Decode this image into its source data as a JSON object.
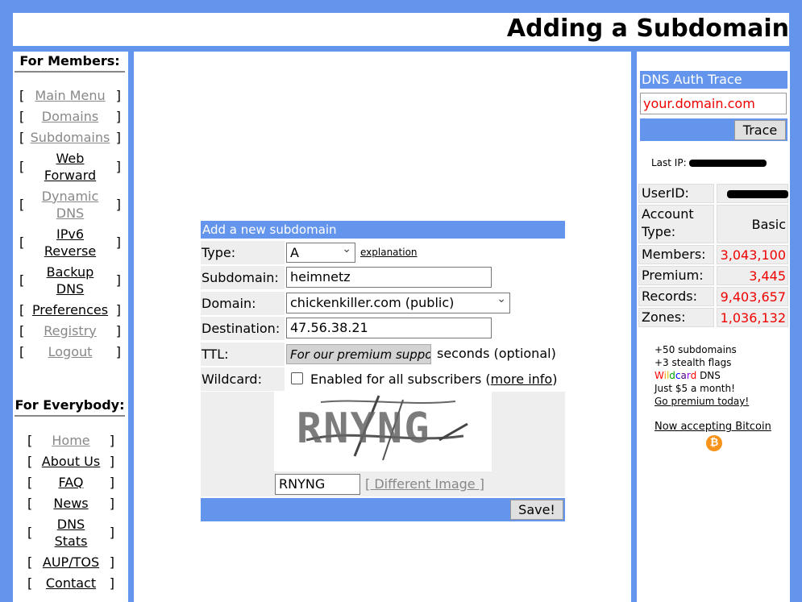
{
  "header": {
    "title": "Adding a Subdomain"
  },
  "left": {
    "members_title": "For Members:",
    "members": [
      {
        "label": "Main Menu",
        "dim": true
      },
      {
        "label": "Domains",
        "dim": true
      },
      {
        "label": "Subdomains",
        "dim": true
      },
      {
        "label": "Web Forward",
        "dim": false
      },
      {
        "label": "Dynamic DNS",
        "dim": true
      },
      {
        "label": "IPv6 Reverse",
        "dim": false
      },
      {
        "label": "Backup DNS",
        "dim": false
      },
      {
        "label": "Preferences",
        "dim": false
      },
      {
        "label": "Registry",
        "dim": true
      },
      {
        "label": "Logout",
        "dim": true
      }
    ],
    "everybody_title": "For Everybody:",
    "everybody": [
      {
        "label": "Home",
        "dim": true
      },
      {
        "label": "About Us",
        "dim": false
      },
      {
        "label": "FAQ",
        "dim": false
      },
      {
        "label": "News",
        "dim": false
      },
      {
        "label": "DNS Stats",
        "dim": false
      },
      {
        "label": "AUP/TOS",
        "dim": false
      },
      {
        "label": "Contact",
        "dim": false
      }
    ],
    "bracket_open": "[",
    "bracket_close": "]"
  },
  "form": {
    "title": "Add a new subdomain",
    "type_label": "Type:",
    "type_value": "A",
    "explanation_link": "explanation",
    "subdomain_label": "Subdomain:",
    "subdomain_value": "heimnetz",
    "domain_label": "Domain:",
    "domain_value": "chickenkiller.com (public)",
    "destination_label": "Destination:",
    "destination_value": "47.56.38.21",
    "ttl_label": "TTL:",
    "ttl_placeholder": "For our premium suppo",
    "ttl_suffix": "seconds (optional)",
    "wildcard_label": "Wildcard:",
    "wildcard_text": "Enabled for all subscribers",
    "wildcard_paren_open": "(",
    "wildcard_more_info": "more info",
    "wildcard_paren_close": ")",
    "captcha_text": "RNYNG",
    "captcha_input_value": "RNYNG",
    "different_image": "[ Different Image ]",
    "save_button": "Save!"
  },
  "right": {
    "trace_title": "DNS Auth Trace",
    "trace_input": "your.domain.com",
    "trace_button": "Trace",
    "last_ip_label": "Last IP:",
    "stats": [
      {
        "label": "UserID:",
        "value": ""
      },
      {
        "label": "Account Type:",
        "value": "Basic"
      },
      {
        "label": "Members:",
        "value": "3,043,100"
      },
      {
        "label": "Premium:",
        "value": "3,445"
      },
      {
        "label": "Records:",
        "value": "9,403,657"
      },
      {
        "label": "Zones:",
        "value": "1,036,132"
      }
    ],
    "promo_line1": "+50 subdomains",
    "promo_line2": "+3 stealth flags",
    "wildcard_word": [
      "W",
      "i",
      "l",
      "d",
      "c",
      "a",
      "r",
      "d"
    ],
    "wildcard_colors": [
      "#ff0000",
      "#ff8c00",
      "#d4c400",
      "#00a000",
      "#0000ff",
      "#4b0082",
      "#8b00ff",
      "#ff0000"
    ],
    "promo_dns": " DNS",
    "promo_line4": "Just $5 a month!",
    "promo_link": "Go premium today!",
    "bitcoin_link": "Now accepting Bitcoin",
    "bitcoin_symbol": "₿",
    "colors": {
      "accent": "#6495ed",
      "number": "#ff0000",
      "bitcoin": "#f7931a"
    }
  }
}
